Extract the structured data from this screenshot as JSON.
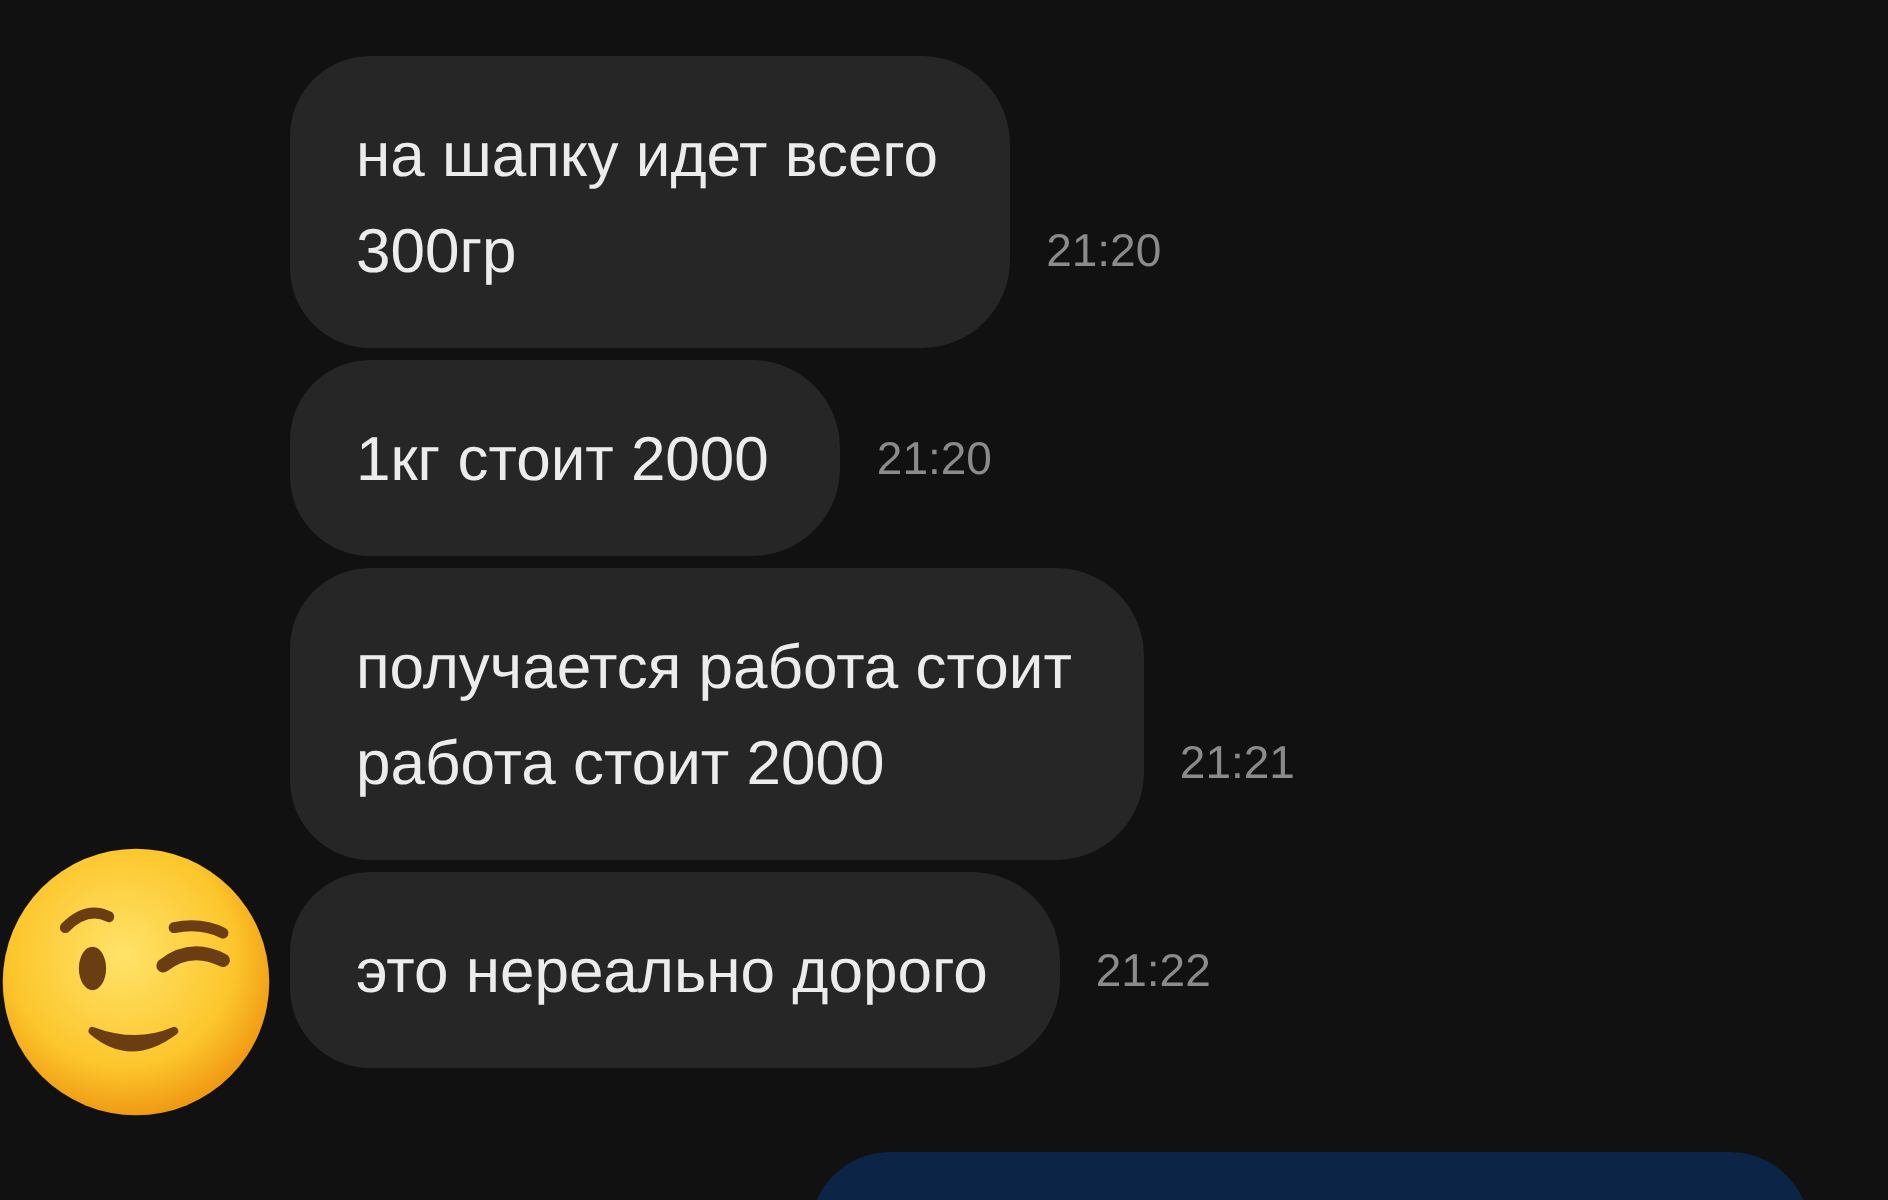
{
  "messages": [
    {
      "text": "на шапку идет всего\n300гр",
      "time": "21:20"
    },
    {
      "text": "1кг стоит 2000",
      "time": "21:20"
    },
    {
      "text": "получается работа стоит\nработа стоит 2000",
      "time": "21:21"
    },
    {
      "text": "это нереально дорого",
      "time": "21:22"
    }
  ],
  "sender": {
    "kind": "emoji"
  },
  "outgoing": {
    "kind": "bubble"
  }
}
